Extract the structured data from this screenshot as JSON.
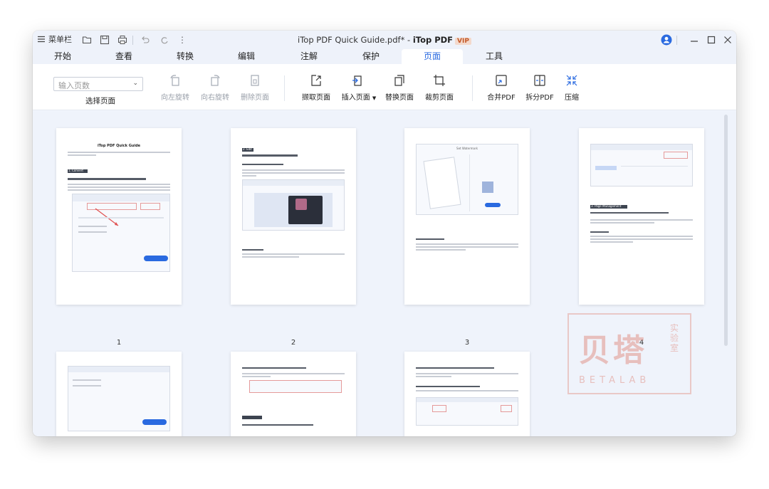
{
  "titlebar": {
    "menu_label": "菜单栏",
    "doc_title": "iTop PDF Quick Guide.pdf*",
    "separator": " - ",
    "app_name": "iTop PDF",
    "vip_badge": "VIP"
  },
  "tabs": [
    {
      "label": "开始"
    },
    {
      "label": "查看"
    },
    {
      "label": "转换"
    },
    {
      "label": "编辑"
    },
    {
      "label": "注解"
    },
    {
      "label": "保护"
    },
    {
      "label": "页面",
      "active": true
    },
    {
      "label": "工具"
    }
  ],
  "ribbon": {
    "page_input_placeholder": "输入页数",
    "select_page_label": "选择页面",
    "buttons": {
      "rotate_left": "向左旋转",
      "rotate_right": "向右旋转",
      "delete_page": "删除页面",
      "extract_page": "撷取页面",
      "insert_page": "插入页面",
      "replace_page": "替换页面",
      "crop_page": "裁剪页面",
      "merge_pdf": "合并PDF",
      "split_pdf": "拆分PDF",
      "compress": "压缩"
    }
  },
  "pages": [
    {
      "number": "1",
      "heading": "iTop PDF Quick Guide",
      "section": "1. Convert"
    },
    {
      "number": "2",
      "section": "2. Edit"
    },
    {
      "number": "3",
      "caption": "Set Watermark"
    },
    {
      "number": "4",
      "section": "3. Page Management"
    },
    {
      "number": ""
    },
    {
      "number": ""
    },
    {
      "number": ""
    }
  ],
  "watermark": {
    "main": "贝塔",
    "side": "实验室",
    "sub": "BETALAB"
  },
  "colors": {
    "accent": "#2a6ae0",
    "window_bg": "#eff3fb",
    "ribbon_bg": "#ffffff",
    "vip": "#c45a2a"
  }
}
